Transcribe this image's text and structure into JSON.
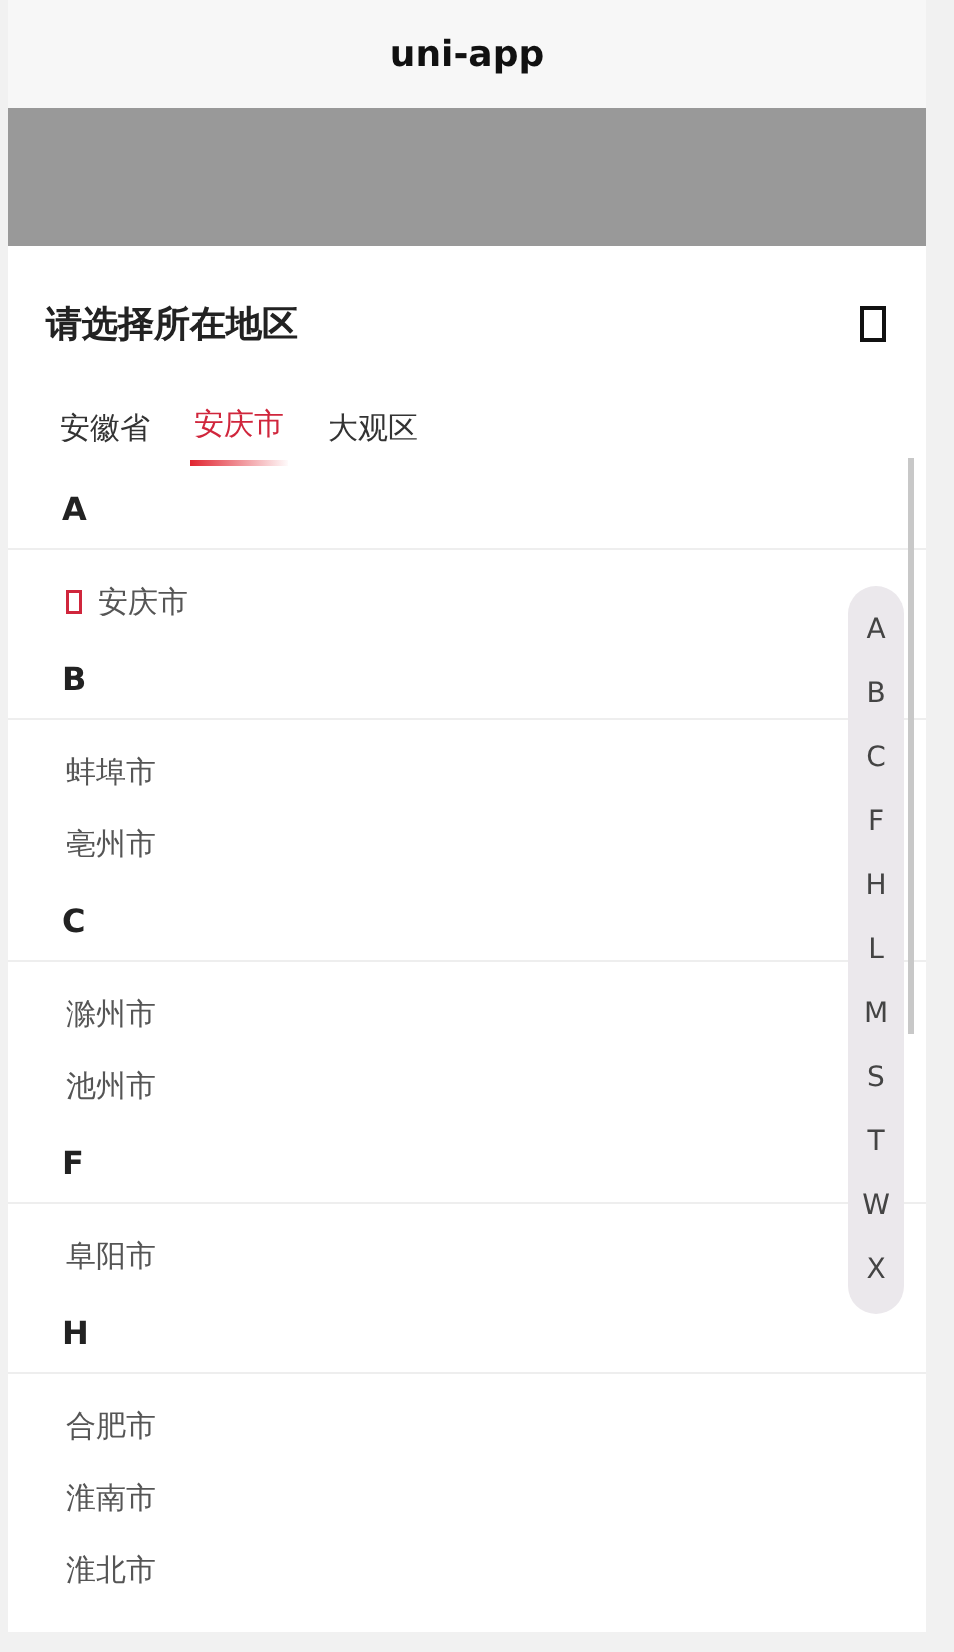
{
  "nav_bar": {
    "title": "uni-app"
  },
  "sheet": {
    "title": "请选择所在地区"
  },
  "tabs": [
    {
      "label": "安徽省",
      "selected": false
    },
    {
      "label": "安庆市",
      "selected": true
    },
    {
      "label": "大观区",
      "selected": false
    }
  ],
  "sections": [
    {
      "letter": "A",
      "cities": [
        {
          "name": "安庆市",
          "selected": true
        }
      ]
    },
    {
      "letter": "B",
      "cities": [
        {
          "name": "蚌埠市",
          "selected": false
        },
        {
          "name": "亳州市",
          "selected": false
        }
      ]
    },
    {
      "letter": "C",
      "cities": [
        {
          "name": "滁州市",
          "selected": false
        },
        {
          "name": "池州市",
          "selected": false
        }
      ]
    },
    {
      "letter": "F",
      "cities": [
        {
          "name": "阜阳市",
          "selected": false
        }
      ]
    },
    {
      "letter": "H",
      "cities": [
        {
          "name": "合肥市",
          "selected": false
        },
        {
          "name": "淮南市",
          "selected": false
        },
        {
          "name": "淮北市",
          "selected": false
        }
      ]
    }
  ],
  "index_bar": [
    "A",
    "B",
    "C",
    "F",
    "H",
    "L",
    "M",
    "S",
    "T",
    "W",
    "X"
  ]
}
